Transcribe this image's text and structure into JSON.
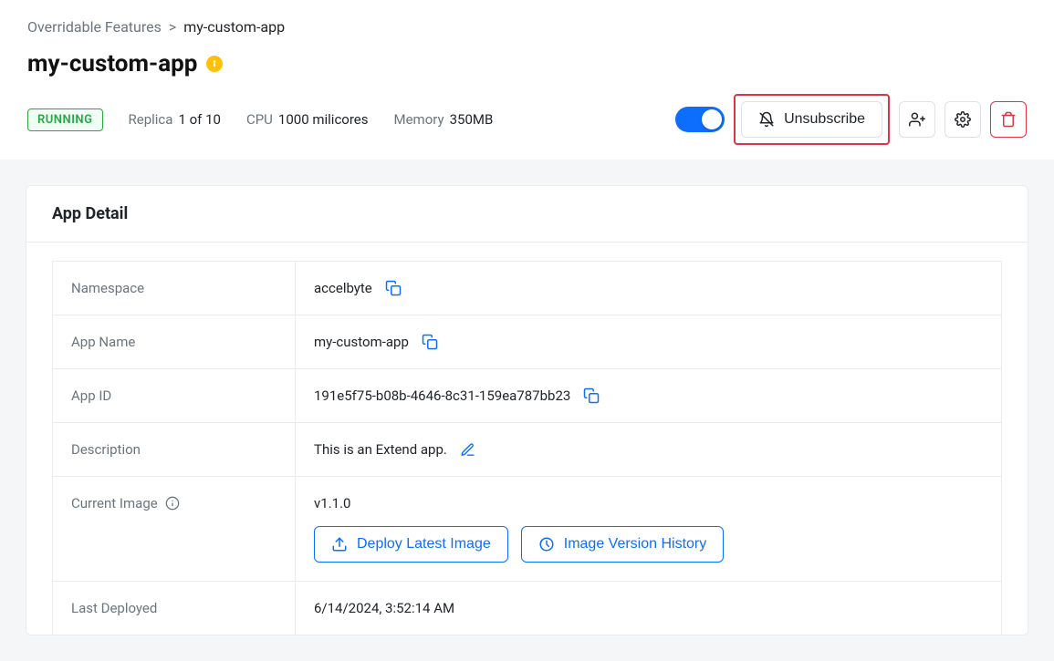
{
  "breadcrumb": {
    "parent": "Overridable Features",
    "current": "my-custom-app"
  },
  "header": {
    "title": "my-custom-app",
    "status": "RUNNING",
    "replica": {
      "label": "Replica",
      "value": "1 of 10"
    },
    "cpu": {
      "label": "CPU",
      "value": "1000 milicores"
    },
    "memory": {
      "label": "Memory",
      "value": "350MB"
    }
  },
  "actions": {
    "unsubscribe": "Unsubscribe"
  },
  "card": {
    "title": "App Detail"
  },
  "detail": {
    "labels": {
      "namespace": "Namespace",
      "app_name": "App Name",
      "app_id": "App ID",
      "description": "Description",
      "current_image": "Current Image",
      "last_deployed": "Last Deployed"
    },
    "values": {
      "namespace": "accelbyte",
      "app_name": "my-custom-app",
      "app_id": "191e5f75-b08b-4646-8c31-159ea787bb23",
      "description": "This is an Extend app.",
      "current_image": "v1.1.0",
      "last_deployed": "6/14/2024, 3:52:14 AM"
    },
    "buttons": {
      "deploy": "Deploy Latest Image",
      "history": "Image Version History"
    }
  }
}
